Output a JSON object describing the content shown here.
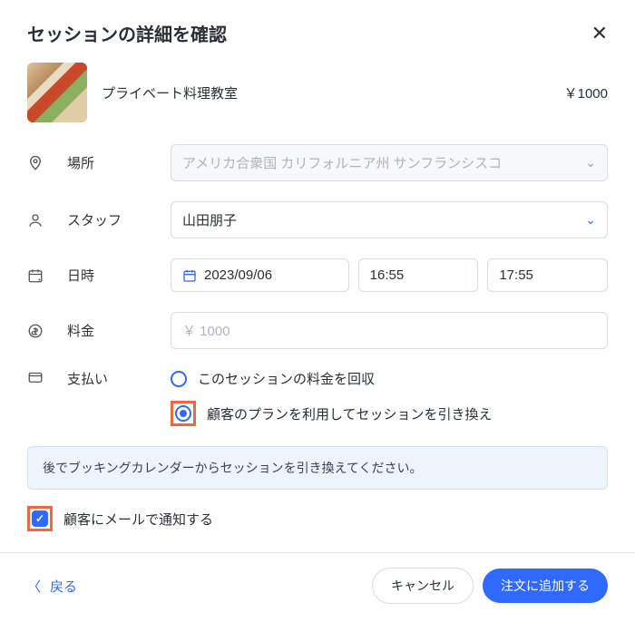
{
  "header": {
    "title": "セッションの詳細を確認"
  },
  "session": {
    "name": "プライベート料理教室",
    "price": "￥1000"
  },
  "fields": {
    "location": {
      "label": "場所",
      "value": "アメリカ合衆国 カリフォルニア州 サンフランシスコ"
    },
    "staff": {
      "label": "スタッフ",
      "value": "山田朋子"
    },
    "datetime": {
      "label": "日時",
      "date": "2023/09/06",
      "start": "16:55",
      "end": "17:55"
    },
    "fee": {
      "label": "料金",
      "placeholder": "￥ 1000"
    },
    "payment": {
      "label": "支払い",
      "option_collect": "このセッションの料金を回収",
      "option_redeem": "顧客のプランを利用してセッションを引き換え"
    }
  },
  "banner": "後でブッキングカレンダーからセッションを引き換えてください。",
  "notify": {
    "label": "顧客にメールで通知する"
  },
  "footer": {
    "back": "戻る",
    "cancel": "キャンセル",
    "submit": "注文に追加する"
  }
}
